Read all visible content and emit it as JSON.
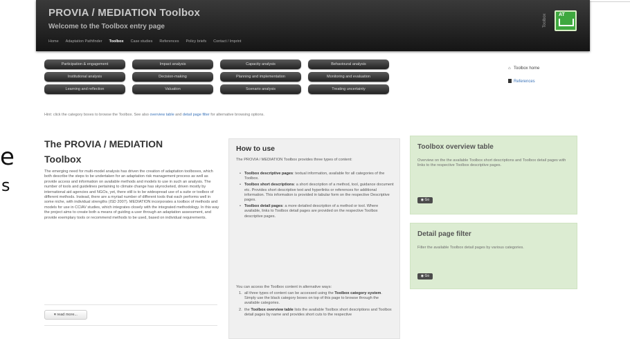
{
  "edge": {
    "letter_e": "e",
    "letter_s": "s"
  },
  "header": {
    "title": "PROVIA / MEDIATION Toolbox",
    "subtitle": "Welcome to the Toolbox entry page",
    "nav": [
      "Home",
      "Adaptation Pathfinder",
      "Toolbox",
      "Case studies",
      "References",
      "Policy briefs",
      "Contact / Imprint"
    ],
    "active_nav": "Toolbox",
    "side_label": "Toolbox",
    "logo_text": "AT"
  },
  "categories": [
    "Participation & engagement",
    "Impact analysis",
    "Capacity analysis",
    "Behavioural analysis",
    "Institutional analysis",
    "Decision-making",
    "Planning and implementation",
    "Monitoring and evaluation",
    "Learning and reflection",
    "Valuation",
    "Scenario analysis",
    "Treating uncertainty"
  ],
  "sidebar": {
    "toolbox_home": "Toolbox home",
    "references": "References"
  },
  "hint": {
    "prefix": "Hint: click the category boxes to browse the Toolbox. See also",
    "overview_link": "overview table",
    "and": "and",
    "filter_link": "detail page filter",
    "suffix": "for alternative browsing options."
  },
  "left": {
    "title": "The PROVIA / MEDIATION Toolbox",
    "body": "The emerging need for multi-model analysis has driven the creation of adaptation toolboxes, which both describe the steps to be undertaken for an adaptation risk management process as well as provide access and information on available methods and models to use in such an analysis. The number of tools and guidelines pertaining to climate change has skyrocketed, driven mostly by international aid agencies and NGOs, yet, there still is to be widespread use of a suite or toolbox of different methods. Instead, there are a myriad number of different tools that each performs well in some niche, with individual strengths (ISD 2007). MEDIATION incorporates a toolbox of methods and models for use in CCIAV studies, which integrates closely with the integrated methodology. In this way the project aims to create both a means of guiding a user through an adaptation assessment, and provide exemplary tools or recommend methods to be used, based on individual requirements.",
    "read_more": "read more..."
  },
  "howto": {
    "title": "How to use",
    "intro": "The PROVIA / MEDIATION Toolbox provides three types of content:",
    "items": [
      {
        "bold": "Toolbox descriptive pages",
        "text": ": textual information, available for all categories of the Toolbox."
      },
      {
        "bold": "Toolbox short descriptions",
        "text": ": a short description of a method, tool, guidance document etc. Provides short descriptive text and hyperlinks or references for additional information. This information is provided in tabular form on the respective Descriptive pages."
      },
      {
        "bold": "Toolbox detail pages",
        "text": ": a more detailed description of a method or tool. Where available, links to Toolbox detail pages are provided on the respective Toolbox descriptive pages."
      }
    ],
    "ways_intro": "You can access the Toolbox content in alternative ways:",
    "ways": [
      {
        "num": "1.",
        "pre": "all three types of content can be accessed using the ",
        "bold": "Toolbox category system",
        "post": ". Simply use the black category boxes on top of this page to browse through the available categories."
      },
      {
        "num": "2.",
        "pre": "the ",
        "bold": "Toolbox overview table",
        "post": " lists the available Toolbox short descriptions and Toolbox detail pages by name and provides short cuts to the respective"
      }
    ]
  },
  "panels": {
    "overview": {
      "title": "Toolbox overview table",
      "text": "Overview on the the available Toolbox short descriptions and Toolbox detail pages with links to the respective Toolbox descriptive pages.",
      "button": "Go"
    },
    "filter": {
      "title": "Detail page filter",
      "text": "Filter the available Toolbox detail pages by various categories.",
      "button": "Go"
    }
  }
}
